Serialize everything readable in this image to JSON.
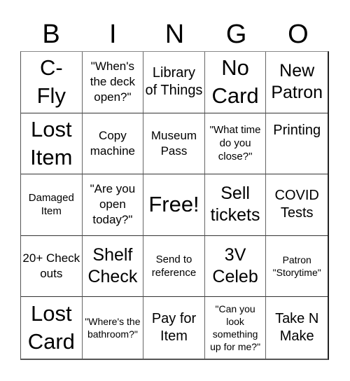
{
  "header": {
    "letters": [
      "B",
      "I",
      "N",
      "G",
      "O"
    ]
  },
  "cells": [
    {
      "text": "C-\nFly",
      "size": "s-xl"
    },
    {
      "text": "\"When's the deck open?\"",
      "size": "s-sm"
    },
    {
      "text": "Library of Things",
      "size": "s-md"
    },
    {
      "text": "No Card",
      "size": "s-xl"
    },
    {
      "text": "New Patron",
      "size": "s-lg"
    },
    {
      "text": "Lost Item",
      "size": "s-xl"
    },
    {
      "text": "Copy machine",
      "size": "s-sm"
    },
    {
      "text": "Museum Pass",
      "size": "s-sm"
    },
    {
      "text": "\"What time do you close?\"",
      "size": "s-xs"
    },
    {
      "text": "Printing",
      "size": "s-md",
      "align": "top"
    },
    {
      "text": "Damaged Item",
      "size": "s-xs"
    },
    {
      "text": "\"Are you open today?\"",
      "size": "s-sm"
    },
    {
      "text": "Free!",
      "size": "s-xl"
    },
    {
      "text": "Sell tickets",
      "size": "s-lg"
    },
    {
      "text": "COVID Tests",
      "size": "s-md"
    },
    {
      "text": "20+ Check outs",
      "size": "s-sm"
    },
    {
      "text": "Shelf Check",
      "size": "s-lg"
    },
    {
      "text": "Send to reference",
      "size": "s-xs"
    },
    {
      "text": "3V Celeb",
      "size": "s-lg"
    },
    {
      "text": "Patron \"Storytime\"",
      "size": "s-xxs"
    },
    {
      "text": "Lost Card",
      "size": "s-xl"
    },
    {
      "text": "\"Where's the bathroom?\"",
      "size": "s-xxs"
    },
    {
      "text": "Pay for Item",
      "size": "s-md"
    },
    {
      "text": "\"Can you look something up for me?\"",
      "size": "s-xxs"
    },
    {
      "text": "Take N Make",
      "size": "s-md"
    }
  ]
}
